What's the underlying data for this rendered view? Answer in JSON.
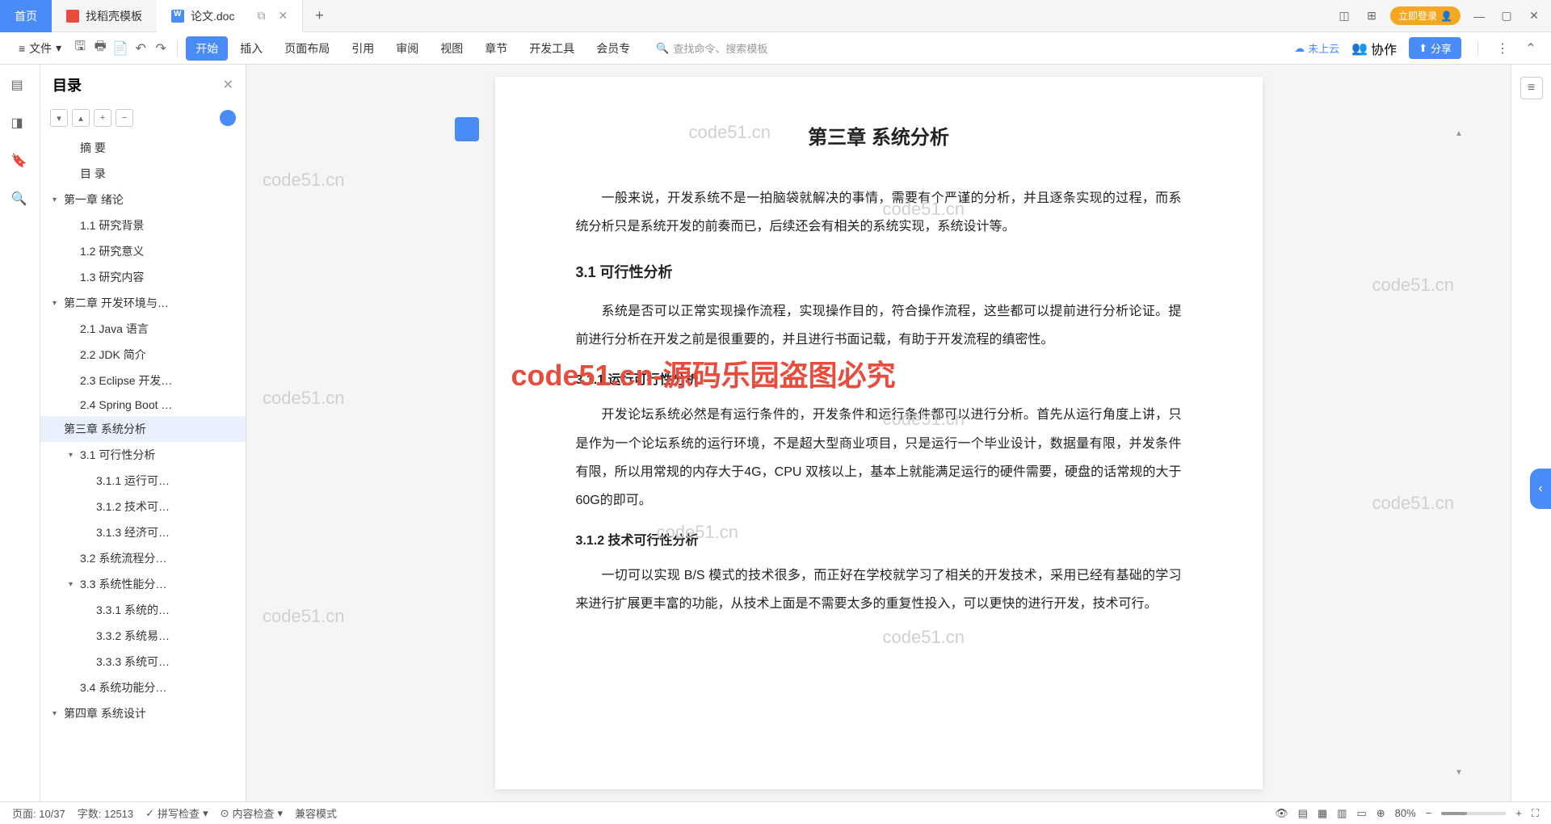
{
  "tabs": {
    "home": "首页",
    "template": "找稻壳模板",
    "doc": "论文.doc"
  },
  "login": "立即登录",
  "file_menu": "文件",
  "ribbons": [
    "开始",
    "插入",
    "页面布局",
    "引用",
    "审阅",
    "视图",
    "章节",
    "开发工具",
    "会员专"
  ],
  "search_ph": "查找命令、搜索模板",
  "cloud": "未上云",
  "collab": "协作",
  "share": "分享",
  "outline": {
    "title": "目录",
    "items": [
      {
        "lv": 1,
        "txt": "摘  要",
        "chev": ""
      },
      {
        "lv": 1,
        "txt": "目  录",
        "chev": ""
      },
      {
        "lv": 0,
        "txt": "第一章  绪论",
        "chev": "▾"
      },
      {
        "lv": 1,
        "txt": "1.1 研究背景",
        "chev": ""
      },
      {
        "lv": 1,
        "txt": "1.2 研究意义",
        "chev": ""
      },
      {
        "lv": 1,
        "txt": "1.3 研究内容",
        "chev": ""
      },
      {
        "lv": 0,
        "txt": "第二章  开发环境与…",
        "chev": "▾"
      },
      {
        "lv": 1,
        "txt": "2.1 Java 语言",
        "chev": ""
      },
      {
        "lv": 1,
        "txt": "2.2 JDK 简介",
        "chev": ""
      },
      {
        "lv": 1,
        "txt": "2.3 Eclipse 开发…",
        "chev": ""
      },
      {
        "lv": 1,
        "txt": "2.4 Spring Boot …",
        "chev": ""
      },
      {
        "lv": 0,
        "txt": "第三章  系统分析",
        "chev": "",
        "active": true
      },
      {
        "lv": 1,
        "txt": "3.1 可行性分析",
        "chev": "▾"
      },
      {
        "lv": 2,
        "txt": "3.1.1 运行可…",
        "chev": ""
      },
      {
        "lv": 2,
        "txt": "3.1.2 技术可…",
        "chev": ""
      },
      {
        "lv": 2,
        "txt": "3.1.3 经济可…",
        "chev": ""
      },
      {
        "lv": 1,
        "txt": "3.2 系统流程分…",
        "chev": ""
      },
      {
        "lv": 1,
        "txt": "3.3  系统性能分…",
        "chev": "▾"
      },
      {
        "lv": 2,
        "txt": "3.3.1 系统的…",
        "chev": ""
      },
      {
        "lv": 2,
        "txt": "3.3.2 系统易…",
        "chev": ""
      },
      {
        "lv": 2,
        "txt": "3.3.3 系统可…",
        "chev": ""
      },
      {
        "lv": 1,
        "txt": "3.4 系统功能分…",
        "chev": ""
      },
      {
        "lv": 0,
        "txt": "第四章  系统设计",
        "chev": "▾"
      }
    ]
  },
  "doc": {
    "h1": "第三章  系统分析",
    "p1": "一般来说，开发系统不是一拍脑袋就解决的事情，需要有个严谨的分析，并且逐条实现的过程，而系统分析只是系统开发的前奏而已，后续还会有相关的系统实现，系统设计等。",
    "h2_1": "3.1 可行性分析",
    "p2": "系统是否可以正常实现操作流程，实现操作目的，符合操作流程，这些都可以提前进行分析论证。提前进行分析在开发之前是很重要的，并且进行书面记载，有助于开发流程的缜密性。",
    "h3_1": "3.1.1 运行可行性分析",
    "p3": "开发论坛系统必然是有运行条件的，开发条件和运行条件都可以进行分析。首先从运行角度上讲，只是作为一个论坛系统的运行环境，不是超大型商业项目，只是运行一个毕业设计，数据量有限，并发条件有限，所以用常规的内存大于4G，CPU 双核以上，基本上就能满足运行的硬件需要，硬盘的话常规的大于 60G的即可。",
    "h3_2": "3.1.2 技术可行性分析",
    "p4": "一切可以实现 B/S 模式的技术很多，而正好在学校就学习了相关的开发技术，采用已经有基础的学习来进行扩展更丰富的功能，从技术上面是不需要太多的重复性投入，可以更快的进行开发，技术可行。"
  },
  "wm": "code51.cn",
  "red_wm": "code51.cn-源码乐园盗图必究",
  "status": {
    "page": "页面: 10/37",
    "words": "字数: 12513",
    "spell": "拼写检查",
    "content": "内容检查",
    "compat": "兼容模式",
    "zoom": "80%"
  }
}
